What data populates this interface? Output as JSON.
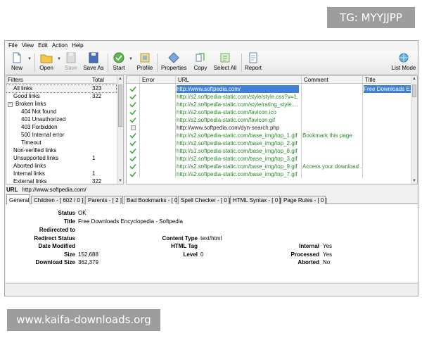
{
  "overlay": {
    "tag": "TG: MYYJJPP",
    "watermark": "www.kaifa-downloads.org"
  },
  "menu": [
    "File",
    "View",
    "Edit",
    "Action",
    "Help"
  ],
  "toolbar": {
    "new": "New",
    "open": "Open",
    "save": "Save",
    "save_as": "Save As",
    "start": "Start",
    "profile": "Profile",
    "properties": "Properties",
    "copy": "Copy",
    "select_all": "Select All",
    "report": "Report",
    "list_mode": "List Mode"
  },
  "filters": {
    "header_filters": "Filters",
    "header_total": "Total",
    "items": [
      {
        "label": "All links",
        "count": "323"
      },
      {
        "label": "Good links",
        "count": "322"
      },
      {
        "label": "Broken links",
        "count": ""
      },
      {
        "label": "404 Not found",
        "count": ""
      },
      {
        "label": "401 Unauthorized",
        "count": ""
      },
      {
        "label": "403 Forbidden",
        "count": ""
      },
      {
        "label": "500 Internal error",
        "count": ""
      },
      {
        "label": "Timeout",
        "count": ""
      },
      {
        "label": "Non-verified links",
        "count": ""
      },
      {
        "label": "Unsupported links",
        "count": "1"
      },
      {
        "label": "Aborted links",
        "count": ""
      },
      {
        "label": "Internal links",
        "count": "1"
      },
      {
        "label": "External links",
        "count": "322"
      }
    ],
    "tree_toggle": "−"
  },
  "urls": {
    "headers": {
      "error": "Error",
      "url": "URL",
      "comment": "Comment",
      "title": "Title"
    },
    "rows": [
      {
        "url": "http://www.softpedia.com/",
        "comment": "",
        "title": "Free Downloads E..."
      },
      {
        "url": "http://s2.softpedia-static.com/style/style.css?v=1...",
        "comment": "",
        "title": ""
      },
      {
        "url": "http://s2.softpedia-static.com/style/rating_style....",
        "comment": "",
        "title": ""
      },
      {
        "url": "http://s2.softpedia-static.com/favicon.ico",
        "comment": "",
        "title": ""
      },
      {
        "url": "http://s2.softpedia-static.com/favicon.gif",
        "comment": "",
        "title": ""
      },
      {
        "url": "http://www.softpedia.com/dyn-search.php",
        "comment": "",
        "title": ""
      },
      {
        "url": "http://s2.softpedia-static.com/base_img/top_1.gif",
        "comment": "Bookmark this page",
        "title": ""
      },
      {
        "url": "http://s2.softpedia-static.com/base_img/top_2.gif",
        "comment": "",
        "title": ""
      },
      {
        "url": "http://s1.softpedia-static.com/base_img/top_8.gif",
        "comment": "",
        "title": ""
      },
      {
        "url": "http://s2.softpedia-static.com/base_img/top_3.gif",
        "comment": "",
        "title": ""
      },
      {
        "url": "http://s2.softpedia-static.com/base_img/top_9.gif",
        "comment": "Access your download ...",
        "title": ""
      },
      {
        "url": "http://s2.softpedia-static.com/base_img/top_7.gif",
        "comment": "",
        "title": ""
      }
    ]
  },
  "urlbar": {
    "label": "URL",
    "value": "http://www.softpedia.com/"
  },
  "tabs": [
    "General",
    "Children - [ 602 / 0 ]",
    "Parents - [ 2 ]",
    "Bad Bookmarks - [ 0 ]",
    "Spell Checker - [ 0 ]",
    "HTML Syntax - [ 0 ]",
    "Page Rules - [ 0 ]"
  ],
  "details": {
    "status_label": "Status",
    "status": "OK",
    "title_label": "Title",
    "title": "Free Downloads Encyclopedia - Softpedia",
    "redirected_to_label": "Redirected to",
    "redirect_status_label": "Redirect Status",
    "date_modified_label": "Date Modified",
    "size_label": "Size",
    "size": "152,688",
    "download_size_label": "Download Size",
    "download_size": "362,379",
    "content_type_label": "Content Type",
    "content_type": "text/html",
    "html_tag_label": "HTML Tag",
    "level_label": "Level",
    "level": "0",
    "internal_label": "Internal",
    "internal": "Yes",
    "processed_label": "Processed",
    "processed": "Yes",
    "aborted_label": "Aborted",
    "aborted": "No"
  },
  "colors": {
    "selection": "#3f7fd6",
    "link_green": "#2a8a2a",
    "check_green": "#3caa3c"
  }
}
